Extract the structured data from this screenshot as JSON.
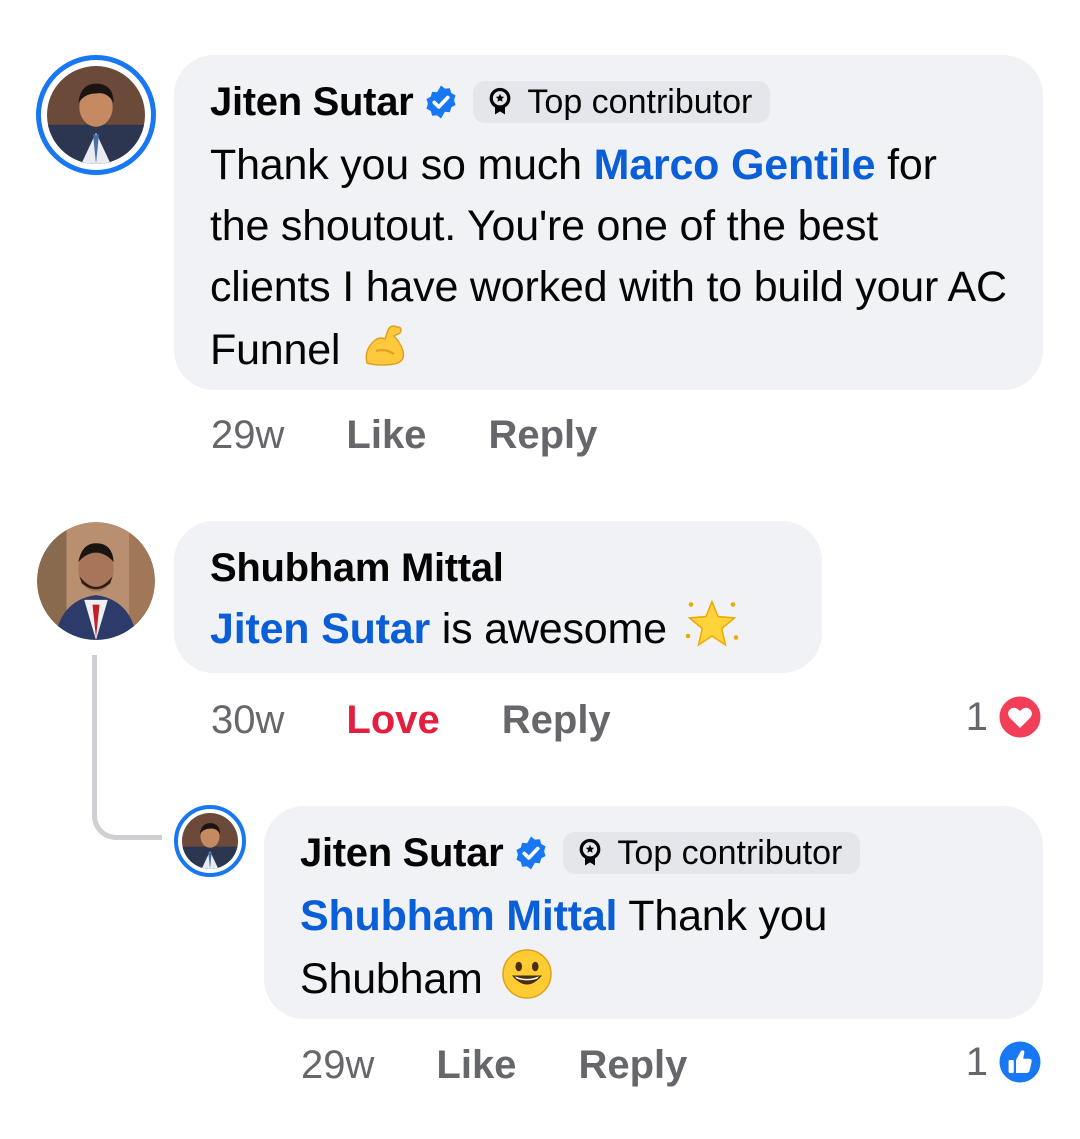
{
  "comments": [
    {
      "author": "Jiten Sutar",
      "verified": true,
      "badge": "Top contributor",
      "text_parts": [
        {
          "t": "Thank you so much "
        },
        {
          "t": "Marco Gentile",
          "mention": true
        },
        {
          "t": " for the shoutout. You're one of the best clients I have worked with to build your AC Funnel"
        }
      ],
      "emoji": "flexed-biceps-emoji",
      "time": "29w",
      "actions": [
        "Like",
        "Reply"
      ]
    },
    {
      "author": "Shubham Mittal",
      "verified": false,
      "text_parts": [
        {
          "t": "Jiten Sutar",
          "mention": true
        },
        {
          "t": " is awesome"
        }
      ],
      "emoji": "glowing-star-emoji",
      "time": "30w",
      "actions": [
        "Love",
        "Reply"
      ],
      "reaction_count": "1",
      "reaction_icon": "heart-icon"
    },
    {
      "author": "Jiten Sutar",
      "verified": true,
      "badge": "Top contributor",
      "text_parts": [
        {
          "t": "Shubham Mittal",
          "mention": true
        },
        {
          "t": " Thank you Shubham"
        }
      ],
      "emoji": "grinning-face-emoji",
      "time": "29w",
      "actions": [
        "Like",
        "Reply"
      ],
      "reaction_count": "1",
      "reaction_icon": "like-icon"
    }
  ],
  "colors": {
    "accent": "#1877f2",
    "mention": "#0a5ed7",
    "love": "#e41e3f",
    "bubble": "#f0f2f5",
    "meta": "#65676b"
  }
}
